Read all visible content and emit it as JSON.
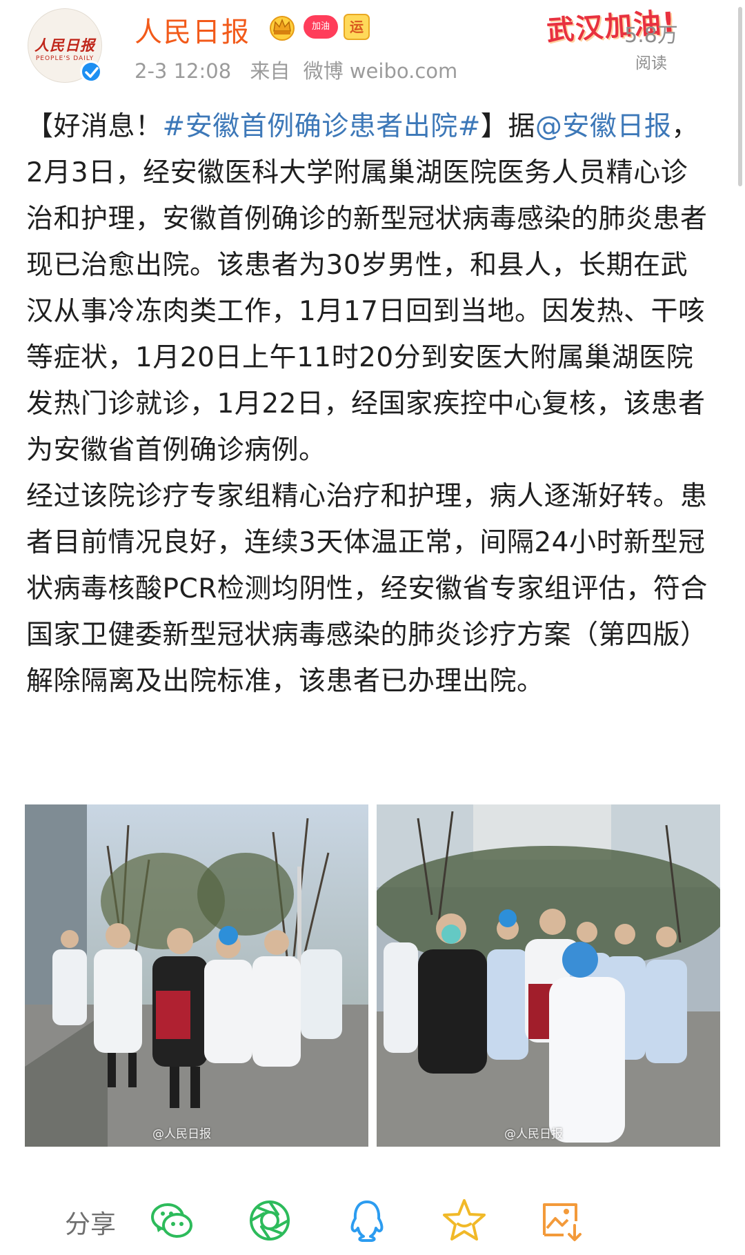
{
  "post": {
    "author": "人民日报",
    "badges": {
      "crown": "crown-badge-icon",
      "jiayou": "加油",
      "yun": "运"
    },
    "time": "2-3 12:08",
    "source_prefix": "来自",
    "source": "微博 weibo.com",
    "campaign": "武汉加油!",
    "read_count": "5.8万",
    "read_label": "阅读",
    "avatar_text": "人民日报",
    "avatar_subtext": "PEOPLE'S DAILY"
  },
  "content": {
    "p1_prefix": "【好消息！",
    "p1_hashtag": "#安徽首例确诊患者出院#",
    "p1_mid": "】据",
    "p1_mention": "@安徽日报",
    "p1_body": "，2月3日，经安徽医科大学附属巢湖医院医务人员精心诊治和护理，安徽首例确诊的新型冠状病毒感染的肺炎患者现已治愈出院。该患者为30岁男性，和县人，长期在武汉从事冷冻肉类工作，1月17日回到当地。因发热、干咳等症状，1月20日上午11时20分到安医大附属巢湖医院发热门诊就诊，1月22日，经国家疾控中心复核，该患者为安徽省首例确诊病例。",
    "p2": "经过该院诊疗专家组精心治疗和护理，病人逐渐好转。患者目前情况良好，连续3天体温正常，间隔24小时新型冠状病毒核酸PCR检测均阴性，经安徽省专家组评估，符合国家卫健委新型冠状病毒感染的肺炎诊疗方案（第四版）解除隔离及出院标准，该患者已办理出院。"
  },
  "photos": [
    {
      "watermark": "@人民日报"
    },
    {
      "watermark": "@人民日报"
    }
  ],
  "actions": {
    "share_label": "分享",
    "icons": [
      "wechat-icon",
      "moments-icon",
      "qq-icon",
      "favorite-star-icon",
      "save-image-icon"
    ]
  },
  "colors": {
    "name_orange": "#f25a1a",
    "link_blue": "#3d78b8",
    "meta_gray": "#9b9b9b",
    "share_green": "#2dbb5b",
    "qq_blue": "#2c9cf0",
    "star_yellow": "#f1b928",
    "save_orange": "#f39a3a"
  }
}
